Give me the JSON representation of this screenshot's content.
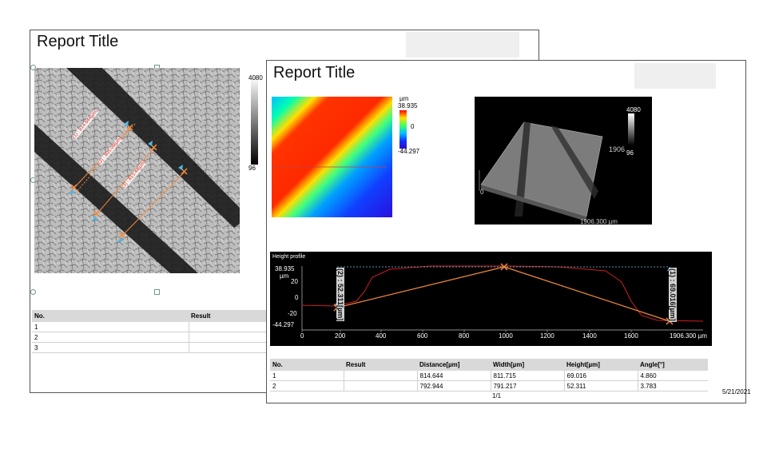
{
  "back_page": {
    "title": "Report Title",
    "scale": {
      "max": "4080",
      "min": "96"
    },
    "measure_labels": [
      "(1) : 814.644[µm]",
      "(2) : 805.09[µm]",
      "(3) : 813.44[µm]"
    ],
    "table": {
      "headers": [
        "No.",
        "Result"
      ],
      "rows": [
        [
          "1",
          ""
        ],
        [
          "2",
          ""
        ],
        [
          "3",
          ""
        ]
      ]
    }
  },
  "front_page": {
    "title": "Report Title",
    "heightmap_scale": {
      "unit": "µm",
      "max": "38.935",
      "mid": "0",
      "min": "-44.297"
    },
    "view3d": {
      "scale_max": "4080",
      "scale_min": "96",
      "axis_y": "1906",
      "axis_x": "1906.300 µm",
      "origin": "0"
    },
    "profile": {
      "title": "Height profile",
      "y_top": "38.935",
      "y_unit": "µm",
      "y_ticks": [
        "20",
        "0",
        "-20"
      ],
      "y_bottom": "-44.297",
      "x_ticks": [
        "0",
        "200",
        "400",
        "600",
        "800",
        "1000",
        "1200",
        "1400",
        "1600"
      ],
      "x_end": "1906.300 µm",
      "label_1": "(1) : 69.016[µm]",
      "label_2": "(2) : 52.311[µm]"
    },
    "table": {
      "headers": [
        "No.",
        "Result",
        "Distance[µm]",
        "Width[µm]",
        "Height[µm]",
        "Angle[°]"
      ],
      "rows": [
        [
          "1",
          "",
          "814.644",
          "811.715",
          "69.016",
          "4.860"
        ],
        [
          "2",
          "",
          "792.944",
          "791.217",
          "52.311",
          "3.783"
        ]
      ]
    },
    "page_number": "1/1",
    "date": "5/21/2021"
  }
}
